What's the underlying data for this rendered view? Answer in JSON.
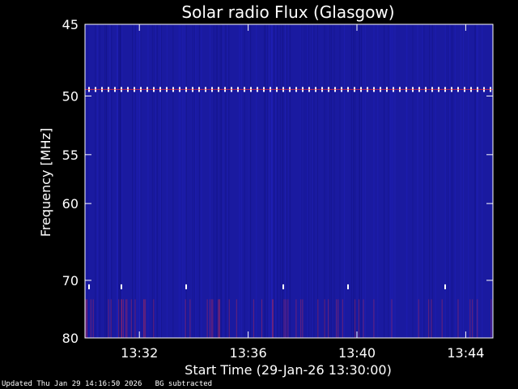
{
  "chart_data": {
    "type": "heatmap",
    "title": "Solar radio Flux (Glasgow)",
    "xlabel": "Start Time (29-Jan-26 13:30:00)",
    "ylabel": "Frequency [MHz]",
    "x_ticks": [
      "13:32",
      "13:36",
      "13:40",
      "13:44"
    ],
    "x_tick_minutes": [
      2,
      6,
      10,
      14
    ],
    "x_range_minutes": [
      0,
      15
    ],
    "y_ticks": [
      45,
      50,
      55,
      60,
      70,
      80
    ],
    "ylim": [
      45,
      80
    ],
    "y_scale": "reciprocal",
    "features": [
      {
        "name": "band",
        "freq_mhz": 49.5,
        "t_start_min": 0,
        "t_end_min": 15
      },
      {
        "name": "band",
        "freq_mhz": 71.0,
        "t_start_min": 0,
        "t_end_min": 15
      }
    ],
    "colors": {
      "background": "#000000",
      "plot": "#1a1aa0",
      "signal": "#ffffff",
      "accent": "#ff3030"
    }
  },
  "footer": {
    "updated": "Updated Thu Jan 29 14:16:50 2026",
    "note": "BG subtracted"
  }
}
